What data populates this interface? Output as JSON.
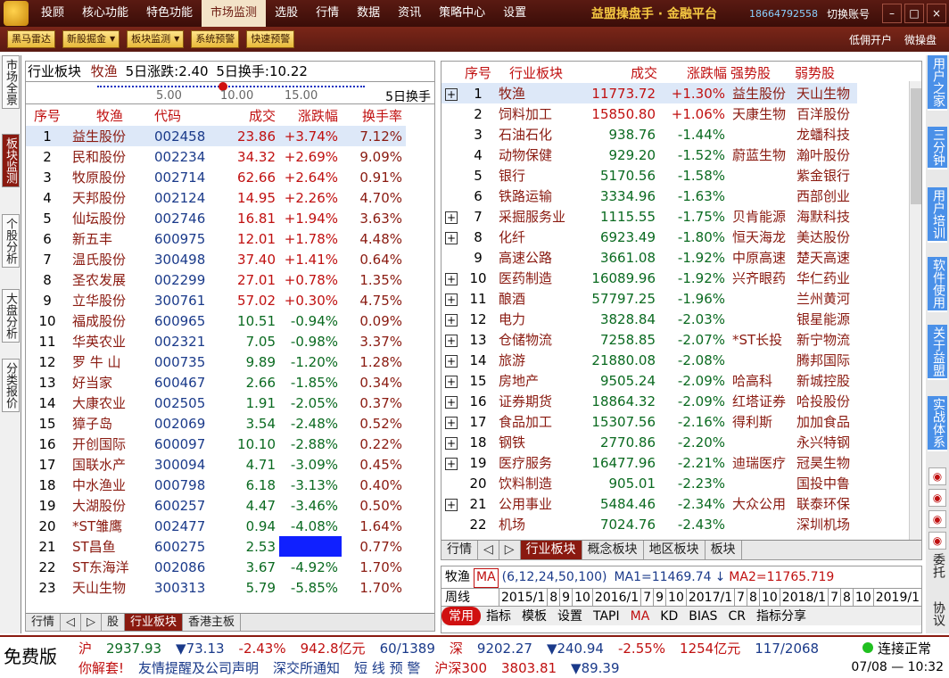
{
  "menu": {
    "items": [
      "投顾",
      "核心功能",
      "特色功能",
      "市场监测",
      "选股",
      "行情",
      "数据",
      "资讯",
      "策略中心",
      "设置"
    ],
    "active": "市场监测",
    "brand": "益盟操盘手 · 金融平台",
    "phone": "18664792558",
    "switch_account": "切换账号"
  },
  "toolbar": {
    "buttons": [
      "黑马雷达",
      "新股掘金",
      "板块监测",
      "系统预警",
      "快速预警"
    ],
    "right": [
      "低佣开户",
      "微操盘"
    ]
  },
  "leftnav": [
    "市场全景",
    "板块监测",
    "个股分析",
    "大盘分析",
    "分类报价"
  ],
  "rightnav": {
    "blue": [
      "用户之家",
      "三分钟",
      "用户培训",
      "软件使用",
      "关于益盟",
      "实战体系"
    ],
    "text": [
      "委托",
      "协议"
    ]
  },
  "left": {
    "header": {
      "label": "行业板块",
      "sector": "牧渔",
      "chg5": "5日涨跌:2.40",
      "turn5": "5日换手:10.22"
    },
    "scale": {
      "ticks": [
        "5.00",
        "10.00",
        "15.00"
      ],
      "button": "5日换手"
    },
    "columns": [
      "序号",
      "牧渔",
      "代码",
      "成交",
      "涨跌幅",
      "换手率"
    ],
    "rows": [
      [
        "1",
        "益生股份",
        "002458",
        "23.86",
        "+3.74%",
        "7.12%"
      ],
      [
        "2",
        "民和股份",
        "002234",
        "34.32",
        "+2.69%",
        "9.09%"
      ],
      [
        "3",
        "牧原股份",
        "002714",
        "62.66",
        "+2.64%",
        "0.91%"
      ],
      [
        "4",
        "天邦股份",
        "002124",
        "14.95",
        "+2.26%",
        "4.70%"
      ],
      [
        "5",
        "仙坛股份",
        "002746",
        "16.81",
        "+1.94%",
        "3.63%"
      ],
      [
        "6",
        "新五丰",
        "600975",
        "12.01",
        "+1.78%",
        "4.48%"
      ],
      [
        "7",
        "温氏股份",
        "300498",
        "37.40",
        "+1.41%",
        "0.64%"
      ],
      [
        "8",
        "圣农发展",
        "002299",
        "27.01",
        "+0.78%",
        "1.35%"
      ],
      [
        "9",
        "立华股份",
        "300761",
        "57.02",
        "+0.30%",
        "4.75%"
      ],
      [
        "10",
        "福成股份",
        "600965",
        "10.51",
        "-0.94%",
        "0.09%"
      ],
      [
        "11",
        "华英农业",
        "002321",
        "7.05",
        "-0.98%",
        "3.37%"
      ],
      [
        "12",
        "罗 牛 山",
        "000735",
        "9.89",
        "-1.20%",
        "1.28%"
      ],
      [
        "13",
        "好当家",
        "600467",
        "2.66",
        "-1.85%",
        "0.34%"
      ],
      [
        "14",
        "大康农业",
        "002505",
        "1.91",
        "-2.05%",
        "0.37%"
      ],
      [
        "15",
        "獐子岛",
        "002069",
        "3.54",
        "-2.48%",
        "0.52%"
      ],
      [
        "16",
        "开创国际",
        "600097",
        "10.10",
        "-2.88%",
        "0.22%"
      ],
      [
        "17",
        "国联水产",
        "300094",
        "4.71",
        "-3.09%",
        "0.45%"
      ],
      [
        "18",
        "中水渔业",
        "000798",
        "6.18",
        "-3.13%",
        "0.40%"
      ],
      [
        "19",
        "大湖股份",
        "600257",
        "4.47",
        "-3.46%",
        "0.50%"
      ],
      [
        "20",
        "*ST雏鹰",
        "002477",
        "0.94",
        "-4.08%",
        "1.64%"
      ],
      [
        "21",
        "ST昌鱼",
        "600275",
        "2.53",
        "",
        "0.77%"
      ],
      [
        "22",
        "ST东海洋",
        "002086",
        "3.67",
        "-4.92%",
        "1.70%"
      ],
      [
        "23",
        "天山生物",
        "300313",
        "5.79",
        "-5.85%",
        "1.70%"
      ]
    ],
    "tabs": [
      "行情",
      "◁",
      "▷",
      "股",
      "行业板块",
      "香港主板"
    ]
  },
  "right": {
    "columns": [
      "序号",
      "行业板块",
      "成交",
      "涨跌幅",
      "强势股",
      "弱势股"
    ],
    "rows": [
      [
        "1",
        "牧渔",
        "11773.72",
        "+1.30%",
        "益生股份",
        "天山生物",
        true
      ],
      [
        "2",
        "饲料加工",
        "15850.80",
        "+1.06%",
        "天康生物",
        "百洋股份",
        false
      ],
      [
        "3",
        "石油石化",
        "938.76",
        "-1.44%",
        "",
        "龙蟠科技",
        false
      ],
      [
        "4",
        "动物保健",
        "929.20",
        "-1.52%",
        "蔚蓝生物",
        "瀚叶股份",
        false
      ],
      [
        "5",
        "银行",
        "5170.56",
        "-1.58%",
        "",
        "紫金银行",
        false
      ],
      [
        "6",
        "铁路运输",
        "3334.96",
        "-1.63%",
        "",
        "西部创业",
        false
      ],
      [
        "7",
        "采掘服务业",
        "1115.55",
        "-1.75%",
        "贝肯能源",
        "海默科技",
        true
      ],
      [
        "8",
        "化纤",
        "6923.49",
        "-1.80%",
        "恒天海龙",
        "美达股份",
        true
      ],
      [
        "9",
        "高速公路",
        "3661.08",
        "-1.92%",
        "中原高速",
        "楚天高速",
        false
      ],
      [
        "10",
        "医药制造",
        "16089.96",
        "-1.92%",
        "兴齐眼药",
        "华仁药业",
        true
      ],
      [
        "11",
        "酿酒",
        "57797.25",
        "-1.96%",
        "",
        "兰州黄河",
        true
      ],
      [
        "12",
        "电力",
        "3828.84",
        "-2.03%",
        "",
        "银星能源",
        true
      ],
      [
        "13",
        "仓储物流",
        "7258.85",
        "-2.07%",
        "*ST长投",
        "新宁物流",
        true
      ],
      [
        "14",
        "旅游",
        "21880.08",
        "-2.08%",
        "",
        "腾邦国际",
        true
      ],
      [
        "15",
        "房地产",
        "9505.24",
        "-2.09%",
        "哈高科",
        "新城控股",
        true
      ],
      [
        "16",
        "证券期货",
        "18864.32",
        "-2.09%",
        "红塔证券",
        "哈投股份",
        true
      ],
      [
        "17",
        "食品加工",
        "15307.56",
        "-2.16%",
        "得利斯",
        "加加食品",
        true
      ],
      [
        "18",
        "钢铁",
        "2770.86",
        "-2.20%",
        "",
        "永兴特钢",
        true
      ],
      [
        "19",
        "医疗服务",
        "16477.96",
        "-2.21%",
        "迪瑞医疗",
        "冠昊生物",
        true
      ],
      [
        "20",
        "饮料制造",
        "905.01",
        "-2.23%",
        "",
        "国投中鲁",
        false
      ],
      [
        "21",
        "公用事业",
        "5484.46",
        "-2.34%",
        "大众公用",
        "联泰环保",
        true
      ],
      [
        "22",
        "机场",
        "7024.76",
        "-2.43%",
        "",
        "深圳机场",
        false
      ]
    ],
    "tabs": [
      "行情",
      "◁",
      "▷",
      "行业板块",
      "概念板块",
      "地区板块",
      "板块"
    ]
  },
  "kline": {
    "name": "牧渔",
    "ind": "MA",
    "params": "(6,12,24,50,100)",
    "ma1": "MA1=11469.74",
    "arrow": "↓",
    "ma2": "MA2=11765.719",
    "garble": "1.425660.422",
    "period": "周线",
    "dates": [
      "2015/1",
      "8",
      "9",
      "10",
      "2016/1",
      "7",
      "9",
      "10",
      "2017/1",
      "7",
      "8",
      "10",
      "2018/1",
      "7",
      "8",
      "10",
      "2019/1"
    ],
    "buttons": [
      "常用",
      "指标",
      "模板",
      "设置",
      "TAPI",
      "MA",
      "KD",
      "BIAS",
      "CR",
      "指标分享"
    ]
  },
  "status": {
    "free": "免费版",
    "sh": [
      "沪",
      "2937.93",
      "▼73.13",
      "-2.43%",
      "942.8亿元",
      "60/1389"
    ],
    "sz": [
      "深",
      "9202.27",
      "▼240.94",
      "-2.55%",
      "1254亿元",
      "117/2068"
    ],
    "conn": "连接正常",
    "row2": [
      "你解套!",
      "友情提醒及公司声明",
      "深交所通知",
      "短 线 预 警"
    ],
    "hs300": [
      "沪深300",
      "3803.81",
      "▼89.39"
    ],
    "time": "07/08 — 10:32"
  },
  "colors": {
    "up": "#c01010",
    "down": "#0a6a20",
    "accent": "#8a1a10",
    "highlight": "#1020ff"
  }
}
